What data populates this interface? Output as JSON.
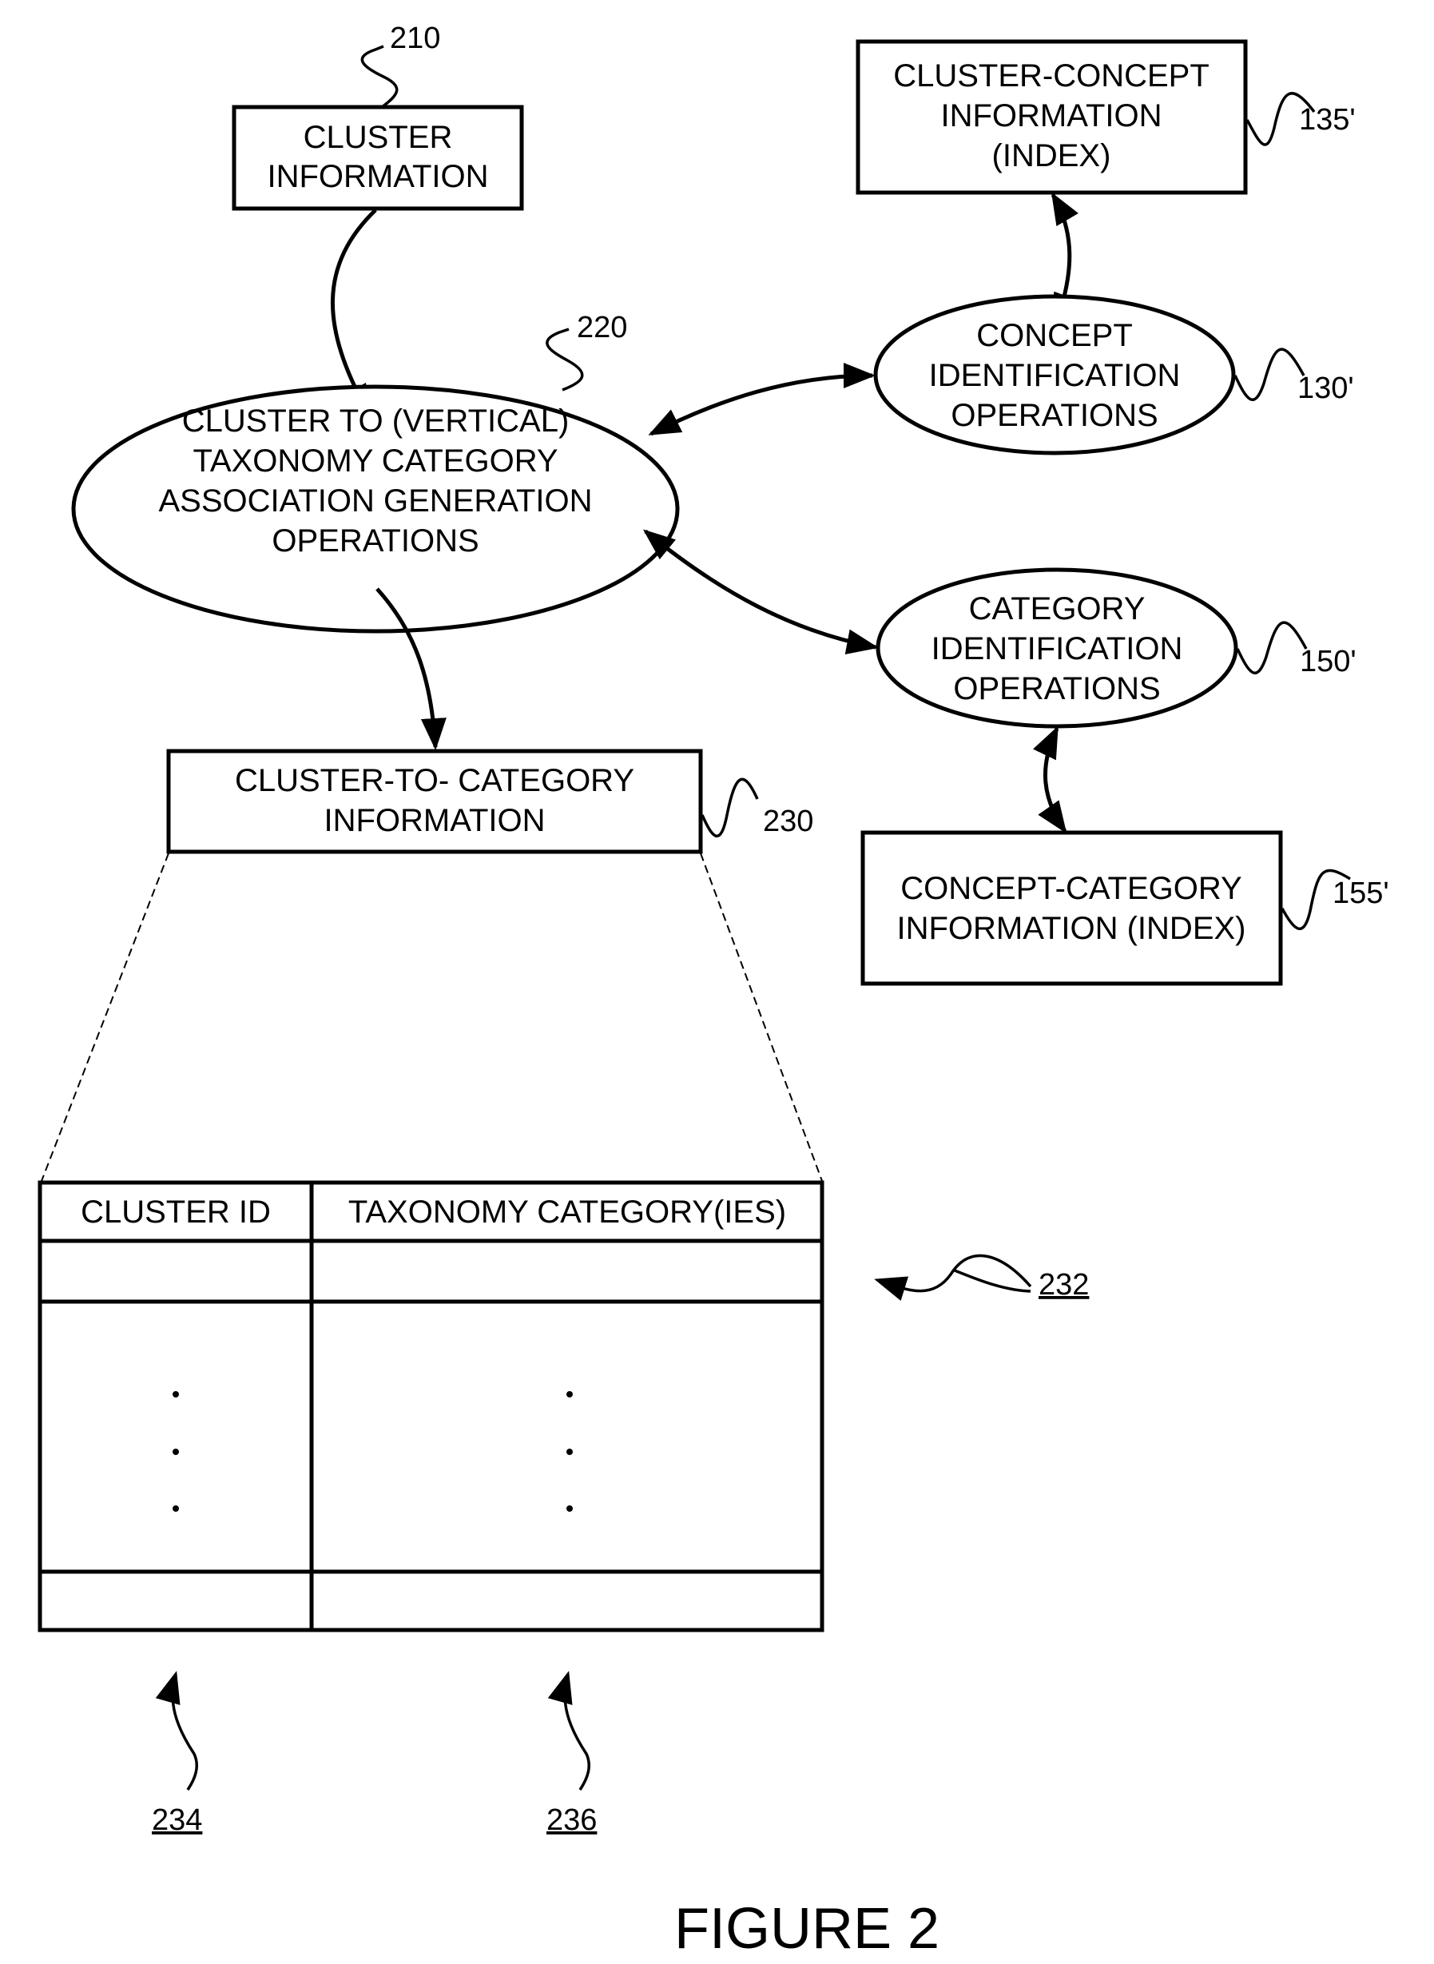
{
  "figure": {
    "caption": "FIGURE 2"
  },
  "nodes": {
    "cluster_info": {
      "ref": "210",
      "lines": [
        "CLUSTER",
        "INFORMATION"
      ]
    },
    "assoc_ops": {
      "ref": "220",
      "lines": [
        "CLUSTER TO (VERTICAL)",
        "TAXONOMY CATEGORY",
        "ASSOCIATION GENERATION",
        "OPERATIONS"
      ]
    },
    "cluster_concept": {
      "ref": "135'",
      "lines": [
        "CLUSTER-CONCEPT",
        "INFORMATION",
        "(INDEX)"
      ]
    },
    "concept_ops": {
      "ref": "130'",
      "lines": [
        "CONCEPT",
        "IDENTIFICATION",
        "OPERATIONS"
      ]
    },
    "category_ops": {
      "ref": "150'",
      "lines": [
        "CATEGORY",
        "IDENTIFICATION",
        "OPERATIONS"
      ]
    },
    "concept_category": {
      "ref": "155'",
      "lines": [
        "CONCEPT-CATEGORY",
        "INFORMATION (INDEX)"
      ]
    },
    "cluster_to_category": {
      "ref": "230",
      "lines": [
        "CLUSTER-TO- CATEGORY",
        "INFORMATION"
      ]
    }
  },
  "table": {
    "ref": "232",
    "columns": [
      {
        "header": "CLUSTER ID",
        "ref": "234"
      },
      {
        "header": "TAXONOMY CATEGORY(IES)",
        "ref": "236"
      }
    ],
    "rows": [
      [
        "",
        ""
      ],
      [
        "...",
        "..."
      ],
      [
        "",
        ""
      ]
    ]
  }
}
